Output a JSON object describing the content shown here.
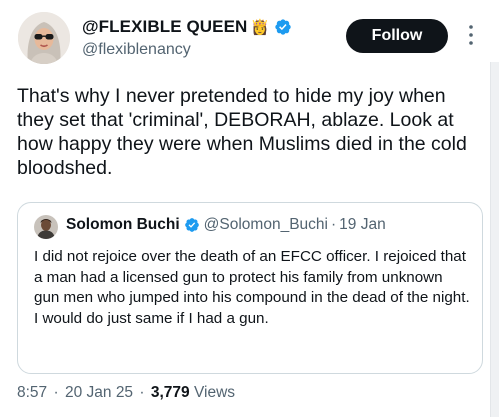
{
  "author": {
    "display_name": "@FLEXIBLE QUEEN",
    "badge_emoji": "👸",
    "handle": "@flexiblenancy",
    "verified": true
  },
  "follow_button": {
    "label": "Follow"
  },
  "tweet": {
    "text": "That's why I never pretended to hide my joy when they set that 'criminal', DEBORAH, ablaze. Look at how happy they were when Muslims died in the cold bloodshed."
  },
  "quoted_tweet": {
    "display_name": "Solomon Buchi",
    "handle": "@Solomon_Buchi",
    "separator": "·",
    "date": "19 Jan",
    "verified": true,
    "text": "I did not rejoice over the death of an EFCC officer. I rejoiced that a man had a licensed gun to protect his family from unknown gun men who jumped into his compound in the dead of the night. I would do just same if I had a gun."
  },
  "meta": {
    "time": "8:57",
    "separator": "·",
    "date": "20 Jan 25",
    "views_count": "3,779",
    "views_label": "Views"
  },
  "colors": {
    "text_primary": "#0f1419",
    "text_secondary": "#536471",
    "verified_blue": "#1d9bf0",
    "follow_bg": "#0f1419",
    "border": "#cfd9de"
  },
  "icons": {
    "verified": "verified-badge-icon",
    "more": "more-vertical-icon"
  }
}
